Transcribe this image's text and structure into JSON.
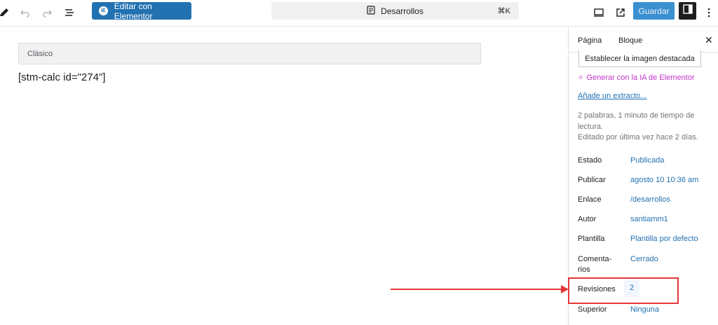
{
  "toolbar": {
    "elementor_label": "Editar con Elementor",
    "document_title": "Desarrollos",
    "shortcut": "⌘K",
    "save_label": "Guardar",
    "icons": [
      "pencil-icon",
      "undo-icon",
      "redo-icon",
      "list-view-icon",
      "document-icon",
      "desktop-preview-icon",
      "external-link-icon",
      "sidebar-toggle-icon",
      "more-options-icon"
    ]
  },
  "editor": {
    "classic_block_label": "Clásico",
    "shortcode": "[stm-calc id=\"274\"]"
  },
  "sidebar": {
    "tabs": [
      "Página",
      "Bloque"
    ],
    "featured_image_button": "Establecer la imagen destacada",
    "ai_generate": "Generar con la IA de Elementor",
    "add_excerpt": "Añade un extracto...",
    "reading_info": "2 palabras, 1 minuto de tiempo de lectura.",
    "last_edited": "Editado por última vez hace 2 días.",
    "rows": [
      {
        "label": "Estado",
        "value": "Publicada"
      },
      {
        "label": "Publicar",
        "value": "agosto 10 10:36 am"
      },
      {
        "label": "Enlace",
        "value": "/desarrollos"
      },
      {
        "label": "Autor",
        "value": "santiamm1"
      },
      {
        "label": "Plantilla",
        "value": "Plantilla por defecto"
      },
      {
        "label": "Comenta-\nrios",
        "value": "Cerrado"
      },
      {
        "label": "Revisiones",
        "value": "2"
      },
      {
        "label": "Superior",
        "value": "Ninguna"
      }
    ]
  },
  "annotation": {
    "color": "#e5363a"
  }
}
